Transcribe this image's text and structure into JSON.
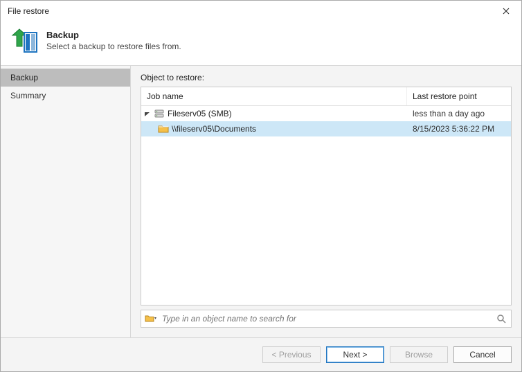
{
  "window": {
    "title": "File restore"
  },
  "header": {
    "title": "Backup",
    "subtitle": "Select a backup to restore files from."
  },
  "sidebar": {
    "items": [
      {
        "label": "Backup",
        "active": true
      },
      {
        "label": "Summary",
        "active": false
      }
    ]
  },
  "main": {
    "label": "Object to restore:",
    "columns": {
      "job": "Job name",
      "restore": "Last restore point"
    },
    "rows": [
      {
        "name": "Fileserv05 (SMB)",
        "restore": "less than a day ago",
        "level": 0,
        "icon": "server",
        "expanded": true,
        "selected": false
      },
      {
        "name": "\\\\fileserv05\\Documents",
        "restore": "8/15/2023 5:36:22 PM",
        "level": 1,
        "icon": "folder",
        "expanded": null,
        "selected": true
      }
    ]
  },
  "search": {
    "placeholder": "Type in an object name to search for"
  },
  "footer": {
    "previous": "< Previous",
    "next": "Next >",
    "browse": "Browse",
    "cancel": "Cancel"
  }
}
